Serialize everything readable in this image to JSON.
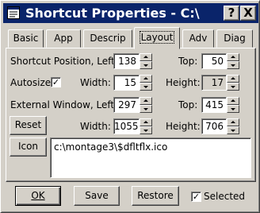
{
  "window": {
    "title": "Shortcut Properties - C:\\"
  },
  "titlebar": {
    "help_label": "?",
    "close_label": "X"
  },
  "tabs": [
    {
      "label": "Basic",
      "active": false
    },
    {
      "label": "App",
      "active": false
    },
    {
      "label": "Descrip",
      "active": false
    },
    {
      "label": "Layout",
      "active": true
    },
    {
      "label": "Adv",
      "active": false
    },
    {
      "label": "Diag",
      "active": false
    }
  ],
  "layout": {
    "shortcut_position_label": "Shortcut Position, Left:",
    "shortcut_left": "138",
    "top_label": "Top:",
    "shortcut_top": "50",
    "autosize_label": "Autosize",
    "autosize_checked": true,
    "width_label": "Width:",
    "shortcut_width": "15",
    "height_label": "Height:",
    "shortcut_height": "17",
    "external_window_label": "External Window, Left:",
    "external_left": "297",
    "external_top": "415",
    "reset_label": "Reset",
    "external_width": "1055",
    "external_height": "706",
    "icon_label": "Icon",
    "icon_path": "c:\\montage3\\$dfltflx.ico"
  },
  "footer": {
    "ok_label": "OK",
    "save_label": "Save",
    "restore_label": "Restore",
    "selected_label": "Selected",
    "selected_checked": true
  }
}
